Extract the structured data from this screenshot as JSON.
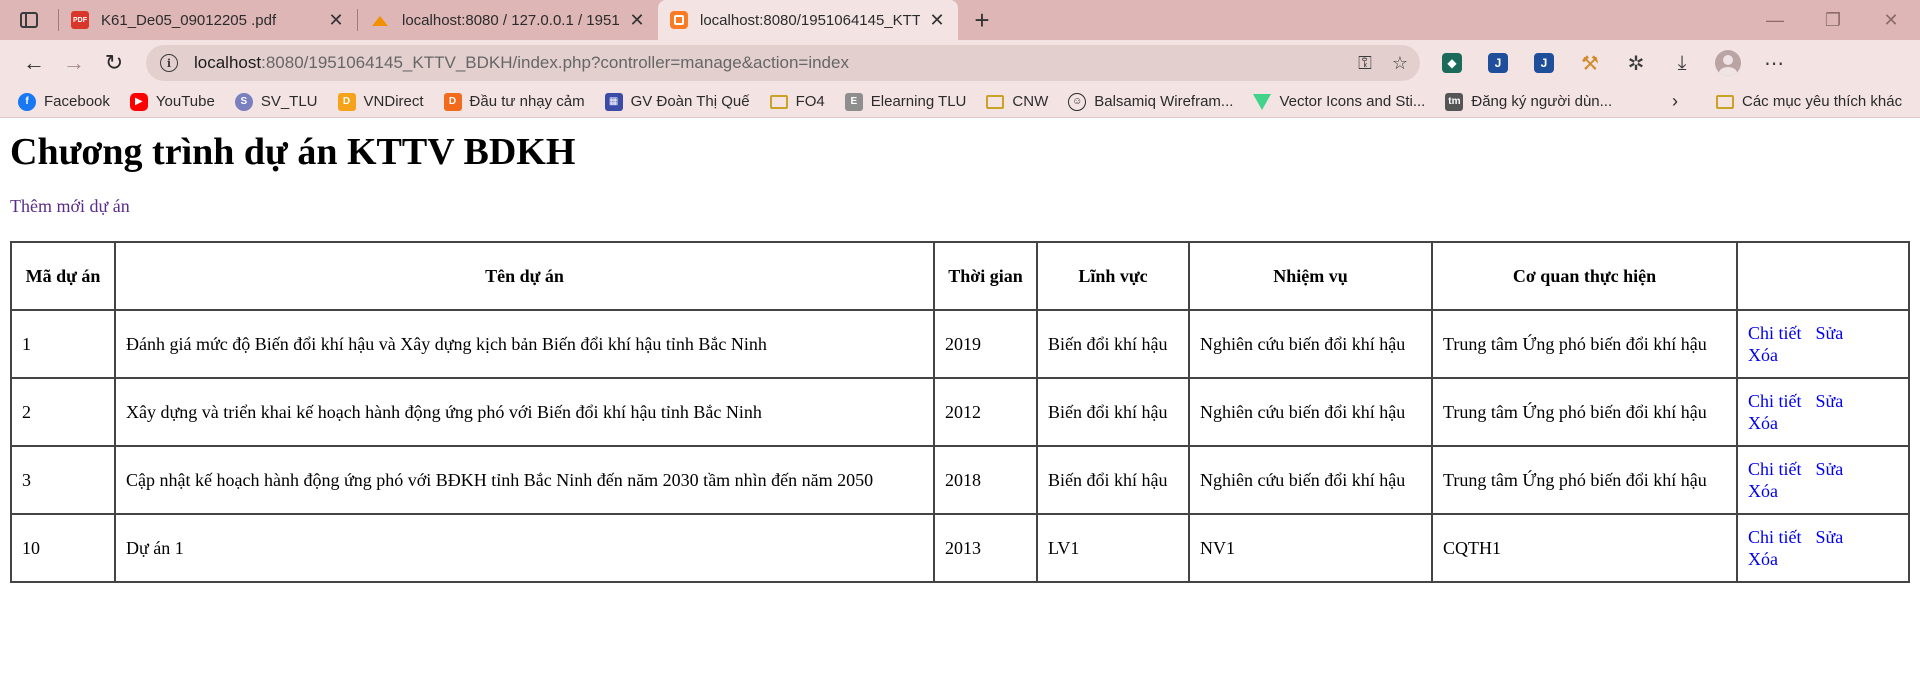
{
  "browser": {
    "tabs": [
      {
        "title": "K61_De05_09012205 .pdf",
        "icon": "pdf-icon"
      },
      {
        "title": "localhost:8080 / 127.0.0.1 / 1951",
        "icon": "phpmyadmin-icon"
      },
      {
        "title": "localhost:8080/1951064145_KTTV",
        "icon": "xampp-icon",
        "active": true
      }
    ],
    "address": {
      "host": "localhost",
      "rest": ":8080/1951064145_KTTV_BDKH/index.php?controller=manage&action=index"
    },
    "bookmarks": [
      {
        "label": "Facebook",
        "icon": "facebook-icon",
        "glyph": "f"
      },
      {
        "label": "YouTube",
        "icon": "youtube-icon",
        "glyph": "▶"
      },
      {
        "label": "SV_TLU",
        "icon": "svtlu-icon",
        "glyph": "S"
      },
      {
        "label": "VNDirect",
        "icon": "vndirect-icon",
        "glyph": "D"
      },
      {
        "label": "Đầu tư nhạy cảm",
        "icon": "dautu-icon",
        "glyph": "D"
      },
      {
        "label": "GV Đoàn Thị Quế",
        "icon": "gv-icon",
        "glyph": "▦"
      },
      {
        "label": "FO4",
        "icon": "folder-icon",
        "glyph": ""
      },
      {
        "label": "Elearning TLU",
        "icon": "elearning-icon",
        "glyph": "E"
      },
      {
        "label": "CNW",
        "icon": "folder-icon",
        "glyph": ""
      },
      {
        "label": "Balsamiq Wirefram...",
        "icon": "balsamiq-icon",
        "glyph": "☺"
      },
      {
        "label": "Vector Icons and Sti...",
        "icon": "vector-icon",
        "glyph": ""
      },
      {
        "label": "Đăng ký người dùn...",
        "icon": "tm-icon",
        "glyph": "tm"
      }
    ],
    "favorites_label": "Các mục yêu thích khác"
  },
  "page": {
    "title": "Chương trình dự án KTTV BDKH",
    "add_link": "Thêm mới dự án",
    "table": {
      "headers": [
        "Mã dự án",
        "Tên dự án",
        "Thời gian",
        "Lĩnh vực",
        "Nhiệm vụ",
        "Cơ quan thực hiện",
        ""
      ],
      "actions": {
        "detail": "Chi tiết",
        "edit": "Sửa",
        "delete": "Xóa"
      },
      "rows": [
        {
          "id": "1",
          "name": "Đánh giá mức độ Biến đổi khí hậu và Xây dựng kịch bản Biến đổi khí hậu tỉnh Bắc Ninh",
          "time": "2019",
          "field": "Biến đổi khí hậu",
          "task": "Nghiên cứu biến đổi khí hậu",
          "org": "Trung tâm Ứng phó biến đổi khí hậu"
        },
        {
          "id": "2",
          "name": "Xây dựng và triển khai kế hoạch hành động ứng phó với Biến đổi khí hậu tỉnh Bắc Ninh",
          "time": "2012",
          "field": "Biến đổi khí hậu",
          "task": "Nghiên cứu biến đổi khí hậu",
          "org": "Trung tâm Ứng phó biến đổi khí hậu"
        },
        {
          "id": "3",
          "name": "Cập nhật kế hoạch hành động ứng phó với BĐKH tỉnh Bắc Ninh đến năm 2030 tầm nhìn đến năm 2050",
          "time": "2018",
          "field": "Biến đổi khí hậu",
          "task": "Nghiên cứu biến đổi khí hậu",
          "org": "Trung tâm Ứng phó biến đổi khí hậu"
        },
        {
          "id": "10",
          "name": "Dự án 1",
          "time": "2013",
          "field": "LV1",
          "task": "NV1",
          "org": "CQTH1"
        }
      ]
    }
  }
}
